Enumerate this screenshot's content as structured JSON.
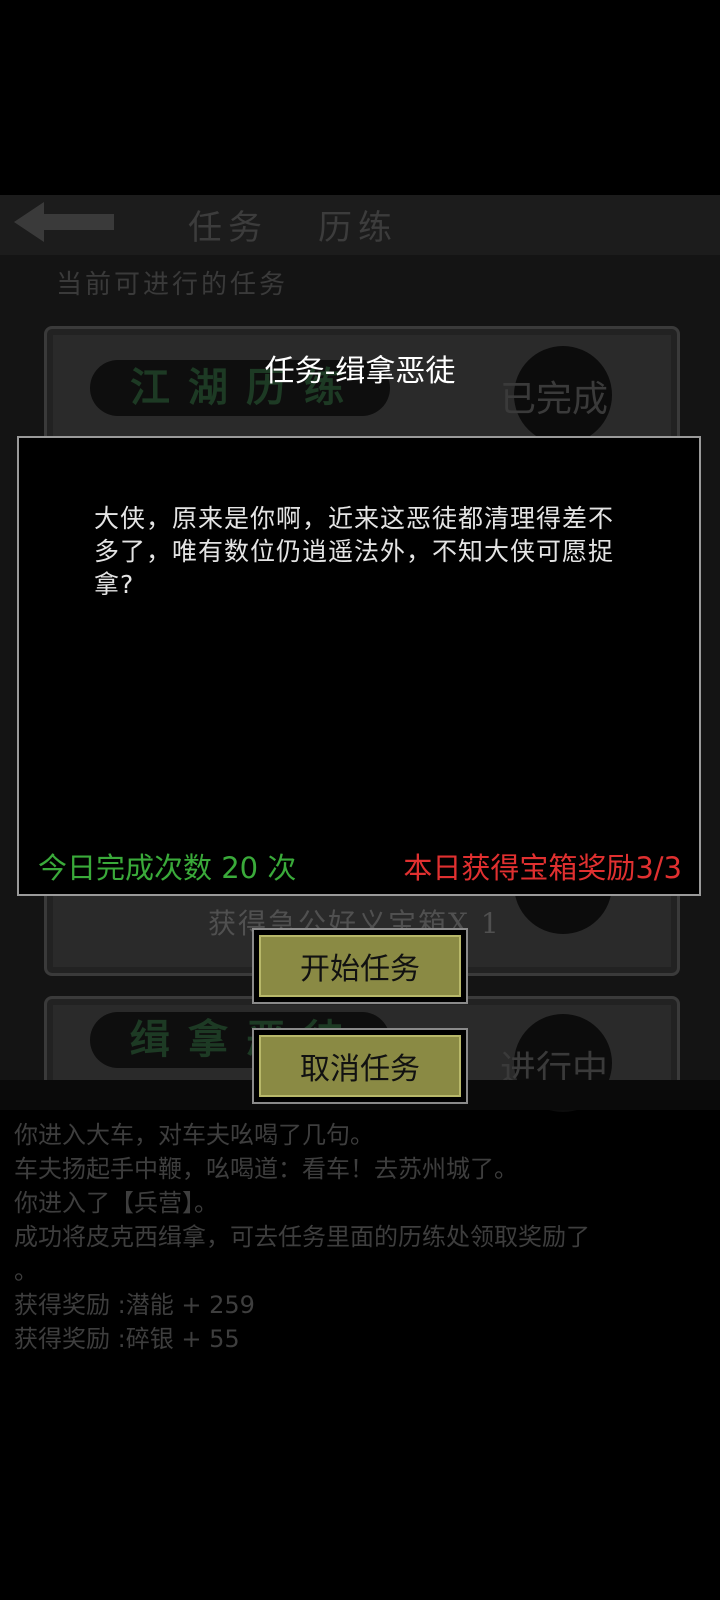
{
  "background": {
    "tabs": [
      "任务",
      "历练"
    ],
    "section_header": "当前可进行的任务",
    "cards": [
      {
        "title": "江湖历练",
        "status": "已完成"
      },
      {
        "title": "",
        "status": ""
      },
      {
        "title": "",
        "status": ""
      },
      {
        "title": "",
        "status": ""
      },
      {
        "title": "缉拿恶徒",
        "status": "进行中"
      }
    ],
    "reward_text": "获得急公好义宝箱X 1",
    "log_lines": [
      "你进入大车，对车夫吆喝了几句。",
      "车夫扬起手中鞭，吆喝道：看车！去苏州城了。",
      "你进入了【兵营】。",
      "成功将皮克西缉拿，可去任务里面的历练处领取奖励了",
      "。",
      "获得奖励 :潜能 + 259",
      "获得奖励 :碎银 + 55"
    ]
  },
  "dialog": {
    "title": "任务-缉拿恶徒",
    "message": "大侠，原来是你啊，近来这恶徒都清理得差不多了，唯有数位仍逍遥法外，不知大侠可愿捉拿?",
    "today_count": "今日完成次数 20 次",
    "chest_reward": "本日获得宝箱奖励3/3",
    "start_button": "开始任务",
    "cancel_button": "取消任务"
  },
  "colors": {
    "count_green": "#3aaa3a",
    "reward_red": "#e03030",
    "button_olive": "#8a8a44"
  }
}
